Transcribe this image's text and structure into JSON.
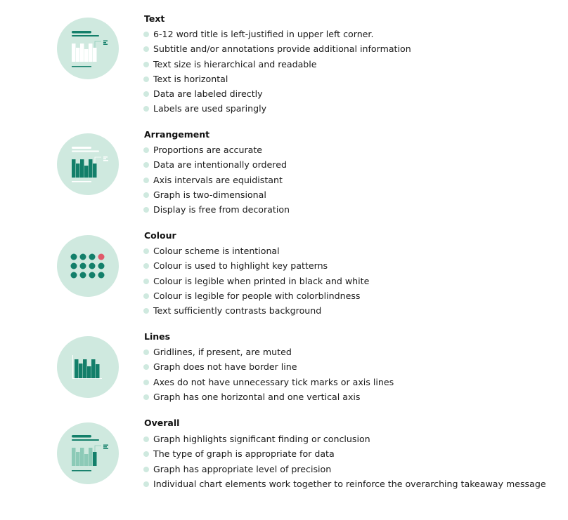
{
  "colors": {
    "circle_bg": "#cfe9df",
    "bullet": "#cfe9df",
    "dark_teal": "#137f6a",
    "light_teal": "#8ccab7",
    "highlight_red": "#e0596a",
    "white": "#ffffff"
  },
  "sections": [
    {
      "heading": "Text",
      "icon": "chart-with-title-icon",
      "items": [
        "6-12 word title is left-justified in upper left corner.",
        "Subtitle and/or annotations provide additional information",
        "Text size is hierarchical and readable",
        "Text is horizontal",
        "Data are labeled directly",
        "Labels are used sparingly"
      ]
    },
    {
      "heading": "Arrangement",
      "icon": "bar-chart-arrangement-icon",
      "items": [
        "Proportions are accurate",
        "Data are intentionally ordered",
        "Axis intervals are equidistant",
        "Graph is two-dimensional",
        "Display is free from decoration"
      ]
    },
    {
      "heading": "Colour",
      "icon": "color-dots-icon",
      "items": [
        "Colour scheme is intentional",
        "Colour is used to highlight key patterns",
        "Colour is legible when printed in black and white",
        "Colour is legible for people with colorblindness",
        "Text sufficiently contrasts background"
      ]
    },
    {
      "heading": "Lines",
      "icon": "bar-chart-axes-icon",
      "items": [
        "Gridlines, if present, are muted",
        "Graph does not have border line",
        "Axes do not have unnecessary tick marks or axis lines",
        "Graph has one horizontal and one vertical axis"
      ]
    },
    {
      "heading": "Overall",
      "icon": "chart-highlight-icon",
      "items": [
        "Graph highlights significant finding or conclusion",
        "The type of graph is appropriate for data",
        "Graph has appropriate level of precision",
        "Individual chart elements work together to reinforce the overarching takeaway message"
      ]
    }
  ]
}
